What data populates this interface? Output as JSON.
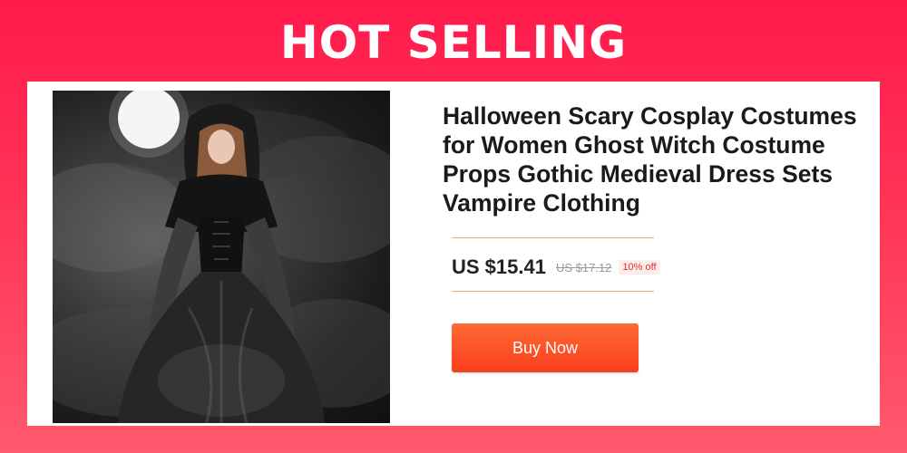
{
  "banner": {
    "title": "HOT SELLING"
  },
  "product": {
    "title": "Halloween Scary Cosplay Costumes for Women Ghost Witch Costume Props Gothic Medieval Dress Sets Vampire Clothing",
    "price": "US $15.41",
    "original_price": "US $17.12",
    "discount": "10% off",
    "buy_label": "Buy Now",
    "image_alt": "woman in hooded black gothic witch dress under full moon"
  },
  "colors": {
    "banner_background": "#ff2a50",
    "title_text": "#ffffff",
    "button": "#fa4a1f",
    "discount_text": "#e0303a",
    "divider": "#f0a58a"
  }
}
